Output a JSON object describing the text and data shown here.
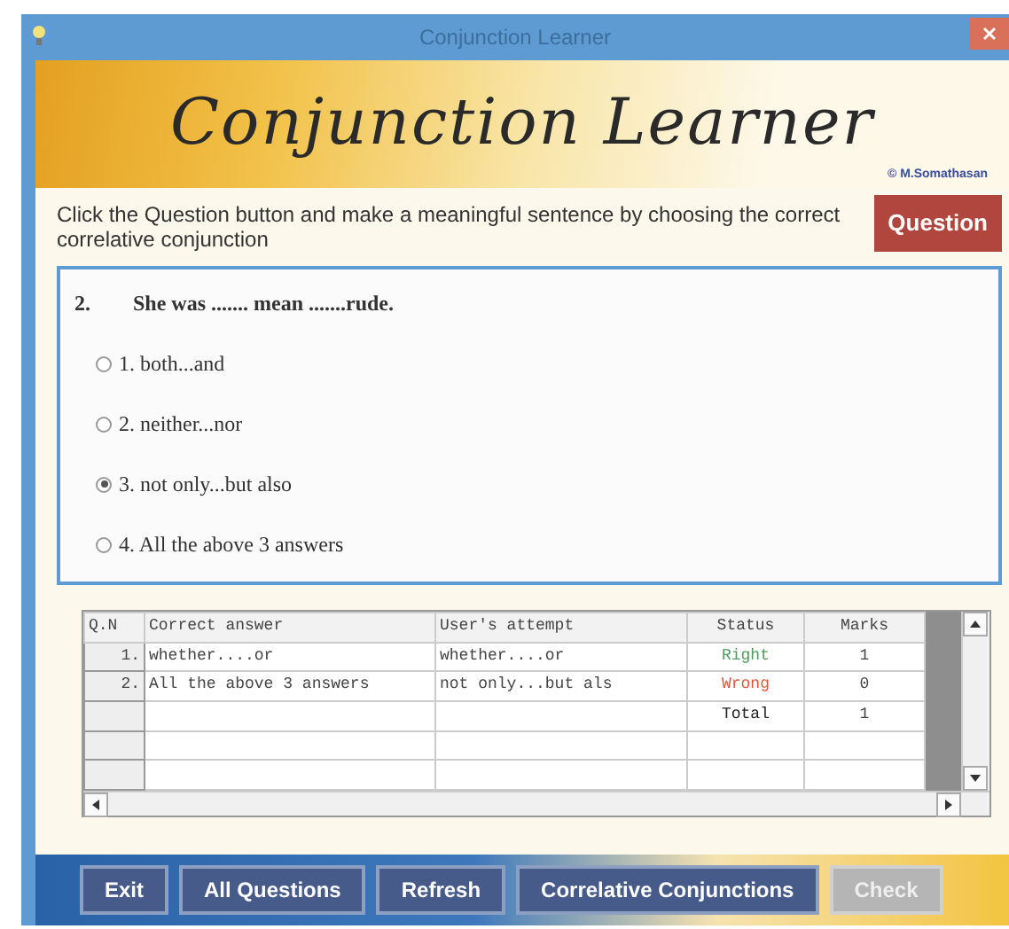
{
  "window": {
    "title": "Conjunction Learner"
  },
  "banner": {
    "title": "Conjunction Learner",
    "credit": "© M.Somathasan"
  },
  "instruction": "Click the Question button and make a meaningful sentence by choosing the correct correlative conjunction",
  "question_button": "Question",
  "question": {
    "number": "2.",
    "text": "She was ....... mean .......rude.",
    "options": [
      {
        "label": "1. both...and",
        "selected": false
      },
      {
        "label": "2. neither...nor",
        "selected": false
      },
      {
        "label": "3. not only...but also",
        "selected": true
      },
      {
        "label": "4. All the above 3 answers",
        "selected": false
      }
    ]
  },
  "table": {
    "columns": [
      "Q.N",
      "Correct answer",
      "User's attempt",
      "Status",
      "Marks"
    ],
    "rows": [
      {
        "number": "1.",
        "correct": "whether....or",
        "attempt": "whether....or",
        "status": "Right",
        "color": "#4f9a5c",
        "marks": "1"
      },
      {
        "number": "2.",
        "correct": "All the above 3 answers",
        "attempt": "not only...but als",
        "status": "Wrong",
        "color": "#e2553a",
        "marks": "0"
      },
      {
        "status": "Total",
        "marks": "1"
      }
    ]
  },
  "buttons": [
    {
      "label": "Exit",
      "disabled": false
    },
    {
      "label": "All Questions",
      "disabled": false
    },
    {
      "label": "Refresh",
      "disabled": false
    },
    {
      "label": "Correlative Conjunctions",
      "disabled": false
    },
    {
      "label": "Check",
      "disabled": true
    }
  ]
}
